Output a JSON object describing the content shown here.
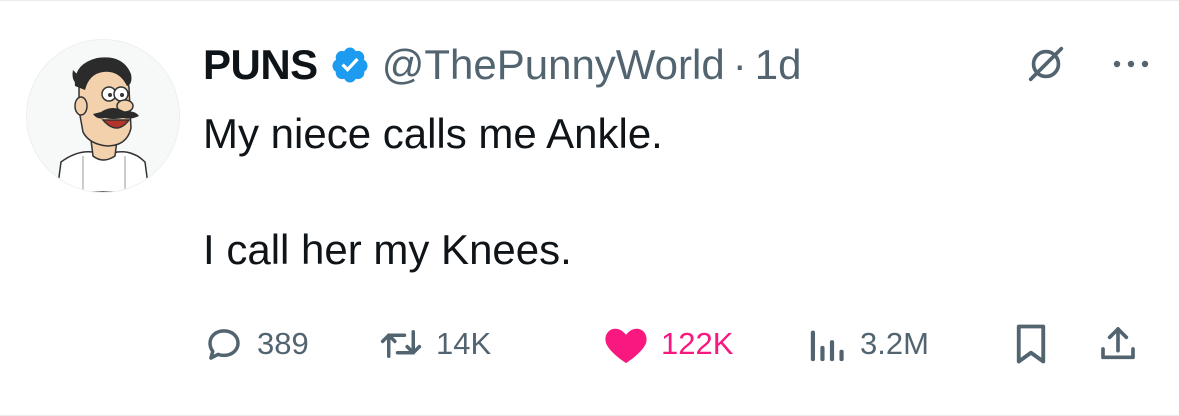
{
  "author": {
    "display_name": "PUNS",
    "handle": "@ThePunnyWorld",
    "separator": "·",
    "timestamp": "1d",
    "verified": true
  },
  "tweet": {
    "line1": "My niece calls me Ankle.",
    "line2": "I call her my Knees."
  },
  "metrics": {
    "replies": "389",
    "retweets": "14K",
    "likes": "122K",
    "views": "3.2M"
  },
  "colors": {
    "verified_blue": "#1d9bf0",
    "like_pink": "#f91880",
    "muted_gray": "#536471",
    "text": "#0f1419"
  },
  "icons": {
    "reply": "speech-bubble-icon",
    "retweet": "retweet-arrows-icon",
    "like": "heart-filled-icon",
    "views": "bar-chart-icon",
    "bookmark": "bookmark-icon",
    "share": "share-upload-icon",
    "grok": "grok-slash-icon",
    "more": "ellipsis-icon"
  }
}
